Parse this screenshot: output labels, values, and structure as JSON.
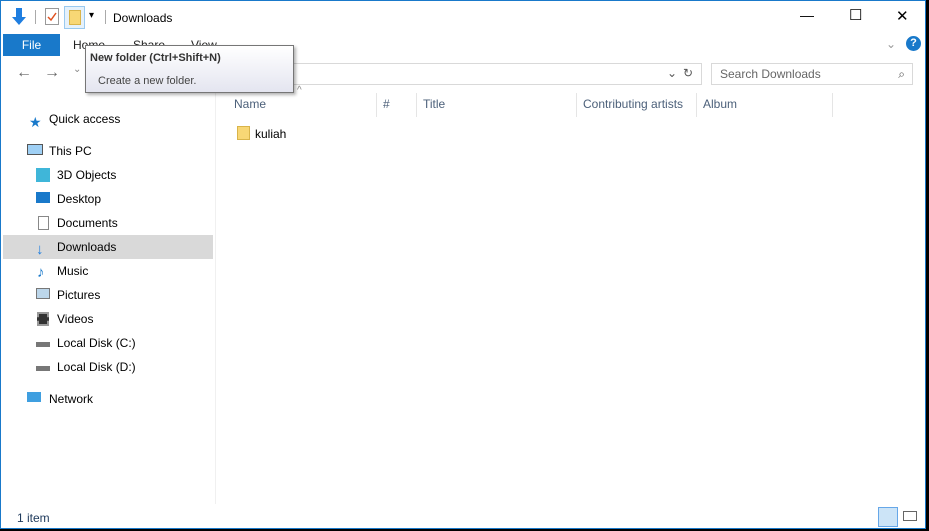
{
  "window": {
    "title": "Downloads",
    "minimize": "—",
    "maximize": "☐",
    "close": "✕"
  },
  "ribbon": {
    "tabs": [
      "File",
      "Home",
      "Share",
      "View"
    ],
    "help": "?"
  },
  "tooltip": {
    "title": "New folder (Ctrl+Shift+N)",
    "body": "Create a new folder."
  },
  "search": {
    "placeholder": "Search Downloads"
  },
  "columns": [
    "Name",
    "#",
    "Title",
    "Contributing artists",
    "Album"
  ],
  "files": [
    {
      "name": "kuliah"
    }
  ],
  "nav": {
    "quick_access": "Quick access",
    "this_pc": "This PC",
    "items": [
      "3D Objects",
      "Desktop",
      "Documents",
      "Downloads",
      "Music",
      "Pictures",
      "Videos",
      "Local Disk (C:)",
      "Local Disk (D:)"
    ],
    "network": "Network",
    "selected": "Downloads"
  },
  "status": {
    "count": "1 item"
  },
  "colors": {
    "accent": "#1979ca",
    "selected": "#d9d9d9",
    "folder": "#f8d775"
  }
}
